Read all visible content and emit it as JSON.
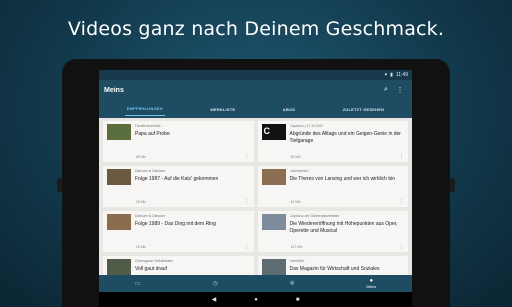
{
  "promo": {
    "headline": "Videos ganz nach Deinem Geschmack."
  },
  "status_bar": {
    "time": "11:49",
    "battery_icon": "battery-icon",
    "wifi_icon": "wifi-icon"
  },
  "app_bar": {
    "title": "Meins",
    "search_icon": "search-icon",
    "menu_icon": "more-vert-icon"
  },
  "tabs": [
    {
      "label": "EMPFEHLUNGEN",
      "active": true
    },
    {
      "label": "MERKLISTE",
      "active": false
    },
    {
      "label": "ABOS",
      "active": false
    },
    {
      "label": "ZULETZT GESEHEN",
      "active": false
    }
  ],
  "cards": [
    {
      "category": "Familienkomödie",
      "title": "Papa auf Probe",
      "duration": "88 Min"
    },
    {
      "category": "Capriccio | 17.10.2017",
      "title": "Abgründe des Alltags und ein Geigen-Genie in der Tiefgarage",
      "duration": "28 Min"
    },
    {
      "category": "Dahoam is Dahoam",
      "title": "Folge 1987 - Auf die Katz' gekommen",
      "duration": "28 Min"
    },
    {
      "category": "Lebenslinien",
      "title": "Die Theres von Lansing und wer ich wirklich bin",
      "duration": "43 Min"
    },
    {
      "category": "Dahoam is Dahoam",
      "title": "Folge 1989 - Das Ding mit dem Ring",
      "duration": "28 Min"
    },
    {
      "category": "Capriccio am Gärtnerplatztheater",
      "title": "Die Wiedereröffnung mit Höhepunkten aus Oper, Operette und Musical",
      "duration": "127 Min"
    },
    {
      "category": "Chiemgauer Volkstheater",
      "title": "Voll gaut drauf",
      "duration": ""
    },
    {
      "category": "mehrWert",
      "title": "Das Magazin für Wirtschaft und Soziales",
      "duration": ""
    }
  ],
  "bottom_nav": [
    {
      "icon": "tv-icon",
      "label": ""
    },
    {
      "icon": "clock-icon",
      "label": ""
    },
    {
      "icon": "gear-icon",
      "label": ""
    },
    {
      "icon": "user-icon",
      "label": "Meins",
      "active": true
    }
  ],
  "system_nav": {
    "back": "◀",
    "home": "●",
    "recents": "■"
  }
}
